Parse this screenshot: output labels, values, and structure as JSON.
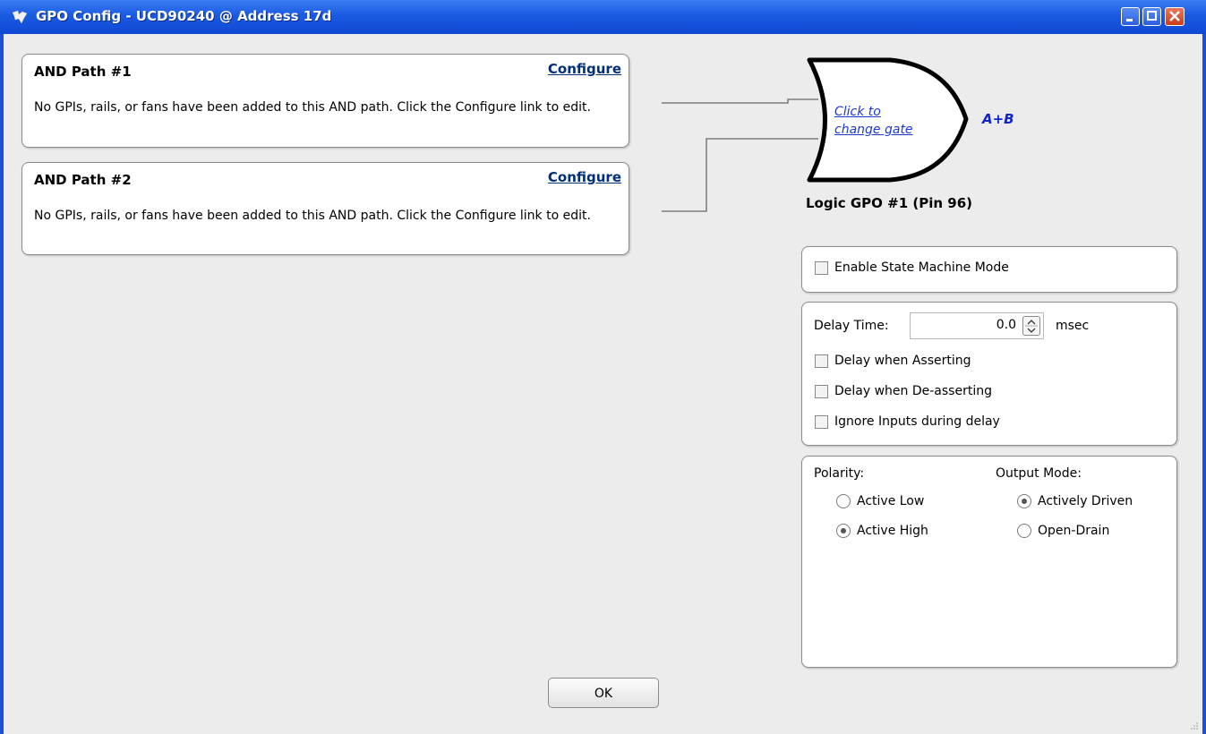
{
  "window": {
    "title": "GPO Config - UCD90240 @ Address 17d"
  },
  "and_paths": [
    {
      "title": "AND Path #1",
      "configure_label": "Configure",
      "description": "No GPIs, rails, or fans have been added to this AND path. Click the Configure link to edit."
    },
    {
      "title": "AND Path #2",
      "configure_label": "Configure",
      "description": "No GPIs, rails, or fans have been added to this AND path. Click the Configure link to edit."
    }
  ],
  "gate": {
    "link_line1": "Click to",
    "link_line2": "change gate",
    "expression": "A+B",
    "gpo_label": "Logic GPO #1 (Pin 96)"
  },
  "state_machine": {
    "label": "Enable State Machine Mode",
    "checked": false
  },
  "delay": {
    "label": "Delay Time:",
    "value": "0.0",
    "unit": "msec",
    "options": [
      {
        "label": "Delay when Asserting",
        "checked": false
      },
      {
        "label": "Delay when De-asserting",
        "checked": false
      },
      {
        "label": "Ignore Inputs during delay",
        "checked": false
      }
    ]
  },
  "polarity": {
    "label": "Polarity:",
    "options": [
      {
        "label": "Active Low",
        "selected": false
      },
      {
        "label": "Active High",
        "selected": true
      }
    ]
  },
  "output_mode": {
    "label": "Output Mode:",
    "options": [
      {
        "label": "Actively Driven",
        "selected": true
      },
      {
        "label": "Open-Drain",
        "selected": false
      }
    ]
  },
  "ok_label": "OK",
  "colors": {
    "titlebar": "#1a5ae3",
    "link": "#00307a",
    "gate_link": "#1d3ad2",
    "expression": "#1026c7",
    "close_button": "#c83d18"
  }
}
